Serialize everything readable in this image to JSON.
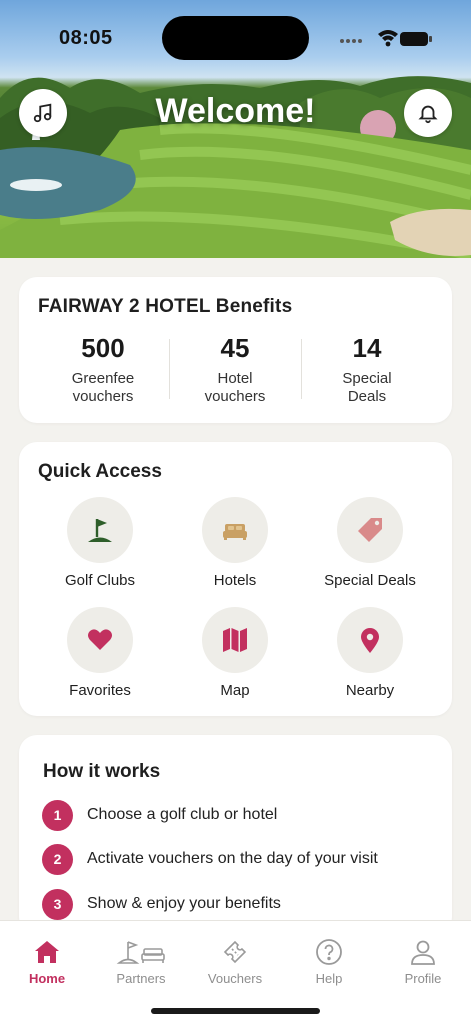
{
  "status_bar": {
    "time": "08:05"
  },
  "hero": {
    "title": "Welcome!",
    "left_button_icon": "music-note-icon",
    "right_button_icon": "bell-icon"
  },
  "benefits": {
    "title": "FAIRWAY 2 HOTEL Benefits",
    "stats": [
      {
        "value": "500",
        "label": "Greenfee\nvouchers"
      },
      {
        "value": "45",
        "label": "Hotel\nvouchers"
      },
      {
        "value": "14",
        "label": "Special\nDeals"
      }
    ]
  },
  "quick_access": {
    "title": "Quick Access",
    "items": [
      {
        "label": "Golf Clubs",
        "icon": "golf-flag-icon"
      },
      {
        "label": "Hotels",
        "icon": "bed-icon"
      },
      {
        "label": "Special Deals",
        "icon": "tag-icon"
      },
      {
        "label": "Favorites",
        "icon": "heart-icon"
      },
      {
        "label": "Map",
        "icon": "map-icon"
      },
      {
        "label": "Nearby",
        "icon": "location-pin-icon"
      }
    ]
  },
  "how_it_works": {
    "title": "How it works",
    "steps": [
      {
        "number": "1",
        "text": "Choose a golf club or hotel"
      },
      {
        "number": "2",
        "text": "Activate vouchers on the day of your visit"
      },
      {
        "number": "3",
        "text": "Show & enjoy your benefits"
      }
    ]
  },
  "tabbar": {
    "tabs": [
      {
        "label": "Home",
        "icon": "home-icon",
        "active": true
      },
      {
        "label": "Partners",
        "icon": "partners-icon",
        "active": false
      },
      {
        "label": "Vouchers",
        "icon": "ticket-icon",
        "active": false
      },
      {
        "label": "Help",
        "icon": "help-icon",
        "active": false
      },
      {
        "label": "Profile",
        "icon": "person-icon",
        "active": false
      }
    ]
  },
  "colors": {
    "accent": "#c2305f",
    "golf_green": "#2e5e2a",
    "hotel_tan": "#c9a064",
    "deal_pink": "#d98a8a",
    "background": "#f3f2ee"
  }
}
